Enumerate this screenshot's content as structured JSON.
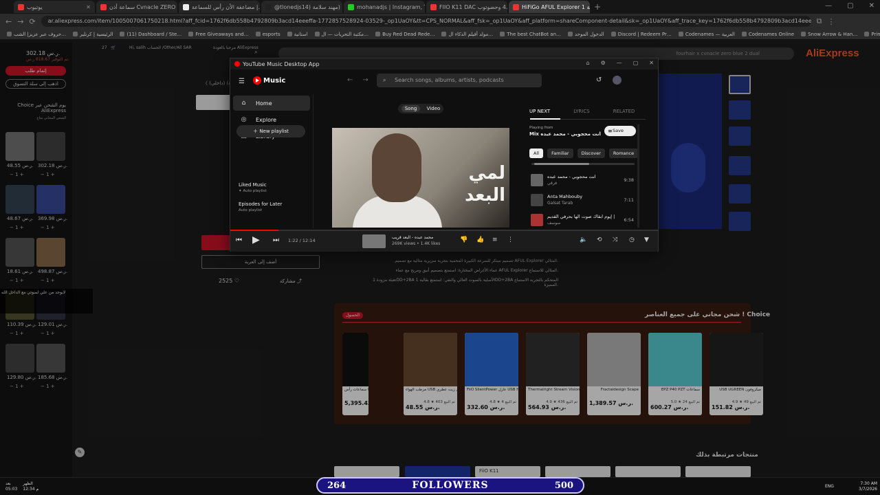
{
  "browser": {
    "tabs": [
      {
        "label": "يوتيوب",
        "color": "#e33"
      },
      {
        "label": "سماعة أذن Cvnacle ZERO 2 AR…",
        "color": "#e33"
      },
      {
        "label": "مضاعفة الأن رأس للسماعة |…",
        "color": "#eee"
      },
      {
        "label": "@tlonedjs14) مهند سلامة) |…",
        "color": "#222"
      },
      {
        "label": "mohanadjs | Instagram, TikTok…",
        "color": "#2c2"
      },
      {
        "label": "FIIO K11 DAC مع 4.4 وحضوتوب…",
        "color": "#e33"
      },
      {
        "label": "HiFiGo AFUL Explorer 1 سماعة",
        "color": "#e33",
        "active": true
      }
    ],
    "url": "ar.aliexpress.com/item/1005007061750218.html?aff_fcid=1762f6db558b4792809b3acd14eeeffa-1772857528924-03529-_op1UaOY&tt=CPS_NORMAL&aff_fsk=_op1UaOY&aff_platform=shareComponent-detail&sk=_op1UaOY&aff_trace_key=1762f6db558b4792809b3acd14eeeffa-1772857528924-03529-_op1UaOY&terminal_id=a7158858aa",
    "bookmarks": [
      "حروف عبر عزيز| الشب…",
      "الرئيسية | كرنلير",
      "(11) Dashboard / Ste…",
      "Free Giveaways and…",
      "esports",
      "استانية",
      "مكتبة التحريات — ال…",
      "Buy Red Dead Rede…",
      "مولد أفيلم الذكاء ال…",
      "The best ChatBot an…",
      "الدخول الموحد",
      "Discord | Redeem Pr…",
      "Codenames — العربية",
      "Codenames Online",
      "Snow Arrow & Han…",
      "Prime Video: The Bo…",
      "All Bookmarks"
    ]
  },
  "aliexpress": {
    "logo": "AliExpress",
    "search_text": "fourhair x cvnacle zero blue 2 dual",
    "header": {
      "signin": "مرحبا بالعودة\nAliExpress",
      "lang": "/Other/All\nSAR",
      "user": "Hi, salih\nالحساب",
      "cart_count": "27",
      "cart": "عربة"
    },
    "breadcrumb": "〈 أعلام(فكرة) (داخلي)",
    "cart": {
      "total": "302.18 ر.س.",
      "saved": "تم التوفير 618.67 ر.س.",
      "checkout": "إتمام طلب",
      "go_cart": "اذهب إلى سلة التسوق",
      "choice_line": "Choice يوم الشحن عبر",
      "choice_brand": "AliExpress",
      "free": "الشحن المجاني متاح",
      "items": [
        {
          "price": "48.55 ر.س.",
          "qty": "1"
        },
        {
          "price": "302.18 ر.س.",
          "qty": "1"
        },
        {
          "price": "48.67 ر.س.",
          "qty": "1"
        },
        {
          "price": "369.98 ر.س.",
          "qty": "1"
        },
        {
          "price": "18.61 ر.س.",
          "qty": "1"
        },
        {
          "price": "498.87 ر.س.",
          "qty": "1"
        },
        {
          "price": "110.39 ر.س.",
          "qty": "1"
        },
        {
          "price": "129.01 ر.س.",
          "qty": "1"
        },
        {
          "price": "129.80 ر.س.",
          "qty": "1"
        },
        {
          "price": "185.68 ر.س.",
          "qty": "1"
        }
      ]
    },
    "add_to_cart": "أضف إلى العربة",
    "likes": "2525",
    "share": "مشاركة",
    "desc": [
      "تصميم مبتكر للسرعة الكبيرة المحمية بتجربة سريرية مثالية مع تصميم AFUL Explorer المثالي.",
      "عماء الأغراض المختارة: استمتع بتصميم أنيق ومريح مع عماء AFUL Explorer المثالي للاستماع.",
      "تعبئة مزودة 1DD+2BA الأصلية بالصوت العالي والنقي: استمتع بقالبة 1DD+2BA المتحكم بالتجربة الاستماع المميزة."
    ],
    "choice": {
      "title": "شحن مجاني على جميع العناصر ! Choice",
      "tag": "الحصول",
      "cards": [
        {
          "name": "سماعات رأس D1",
          "rating": "",
          "price": "5,395.43",
          "color": "#111"
        },
        {
          "name": "مرطب الهواء USB محمول زيت عطري",
          "rating": "4.8 ★ 403 تم البيع",
          "price": "48.55 ر.س.",
          "color": "#6a4a30"
        },
        {
          "name": "FiiO SilentPower عازل USB HDMI iSilencer",
          "rating": "4.8 ★ تم البيع 4",
          "price": "332.60 ر.س.",
          "color": "#2a6ad8"
        },
        {
          "name": "Thermalright Stream Vision",
          "rating": "4.9 ★ 436 تم البيع",
          "price": "564.93 ر.س.",
          "color": "#333"
        },
        {
          "name": "Fractaldesign Scape",
          "rating": "",
          "price": "1,389.57 ر.س.",
          "color": "#bbb"
        },
        {
          "name": "EPZ P40 PZT سماعات",
          "rating": "5.0 ★ 24 تم البيع",
          "price": "600.27 ر.س.",
          "color": "#5ad0d8"
        },
        {
          "name": "USB UGREEN ميكروفون",
          "rating": "4.9 ★ 49 تم البيع",
          "price": "151.82 ر.س.",
          "color": "#222"
        }
      ]
    },
    "related_title": "منتجات مرتبطة بذلك",
    "related_card": "FiiO K11",
    "chat_overlay": "لايوجد من علي لصوتي مع الداخل الله"
  },
  "ytmusic": {
    "window_title": "YouTube Music Desktop App",
    "logo": "Music",
    "search_placeholder": "Search songs, albums, artists, podcasts",
    "nav": [
      {
        "label": "Home",
        "icon": "⌂"
      },
      {
        "label": "Explore",
        "icon": "◎"
      },
      {
        "label": "Library",
        "icon": "▣"
      }
    ],
    "new_playlist": "New playlist",
    "playlists": [
      {
        "name": "Liked Music",
        "sub": "Auto playlist"
      },
      {
        "name": "Episodes for Later",
        "sub": "Auto playlist"
      }
    ],
    "toggle": {
      "song": "Song",
      "video": "Video"
    },
    "art_text": "لمي\nالبعد",
    "tabs": {
      "up_next": "UP NEXT",
      "lyrics": "LYRICS",
      "related": "RELATED"
    },
    "playing_from": "Playing from",
    "playing_list": "Mix انت محجوبي - محمد عبده",
    "save": "Save",
    "chips": [
      "All",
      "Familiar",
      "Discover",
      "Romance"
    ],
    "queue": [
      {
        "title": "انت محجوبي - محمد عبده",
        "artist": "فرقي",
        "duration": "9:38",
        "color": "#666"
      },
      {
        "title": "Anta Mahbouby",
        "artist": "Galsat Tarab",
        "duration": "7:11",
        "color": "#444"
      },
      {
        "title": "عبده | إيوم ابقاك صوت الها بحرفي القديم",
        "artist": "سوسف",
        "duration": "6:54",
        "color": "#a33"
      }
    ],
    "player": {
      "time": "1:22 / 12:14",
      "song": "محمد عبده - البعد قريب",
      "meta": "269K views • 1.4K likes"
    }
  },
  "taskbar": {
    "left": "الظهر\n12:34 م",
    "left2": "بعد\n05:03",
    "followers_left": "264",
    "followers_label": "FOLLOWERS",
    "followers_right": "500",
    "lang": "ENG",
    "time": "7:30 AM",
    "date": "3/7/2026"
  }
}
